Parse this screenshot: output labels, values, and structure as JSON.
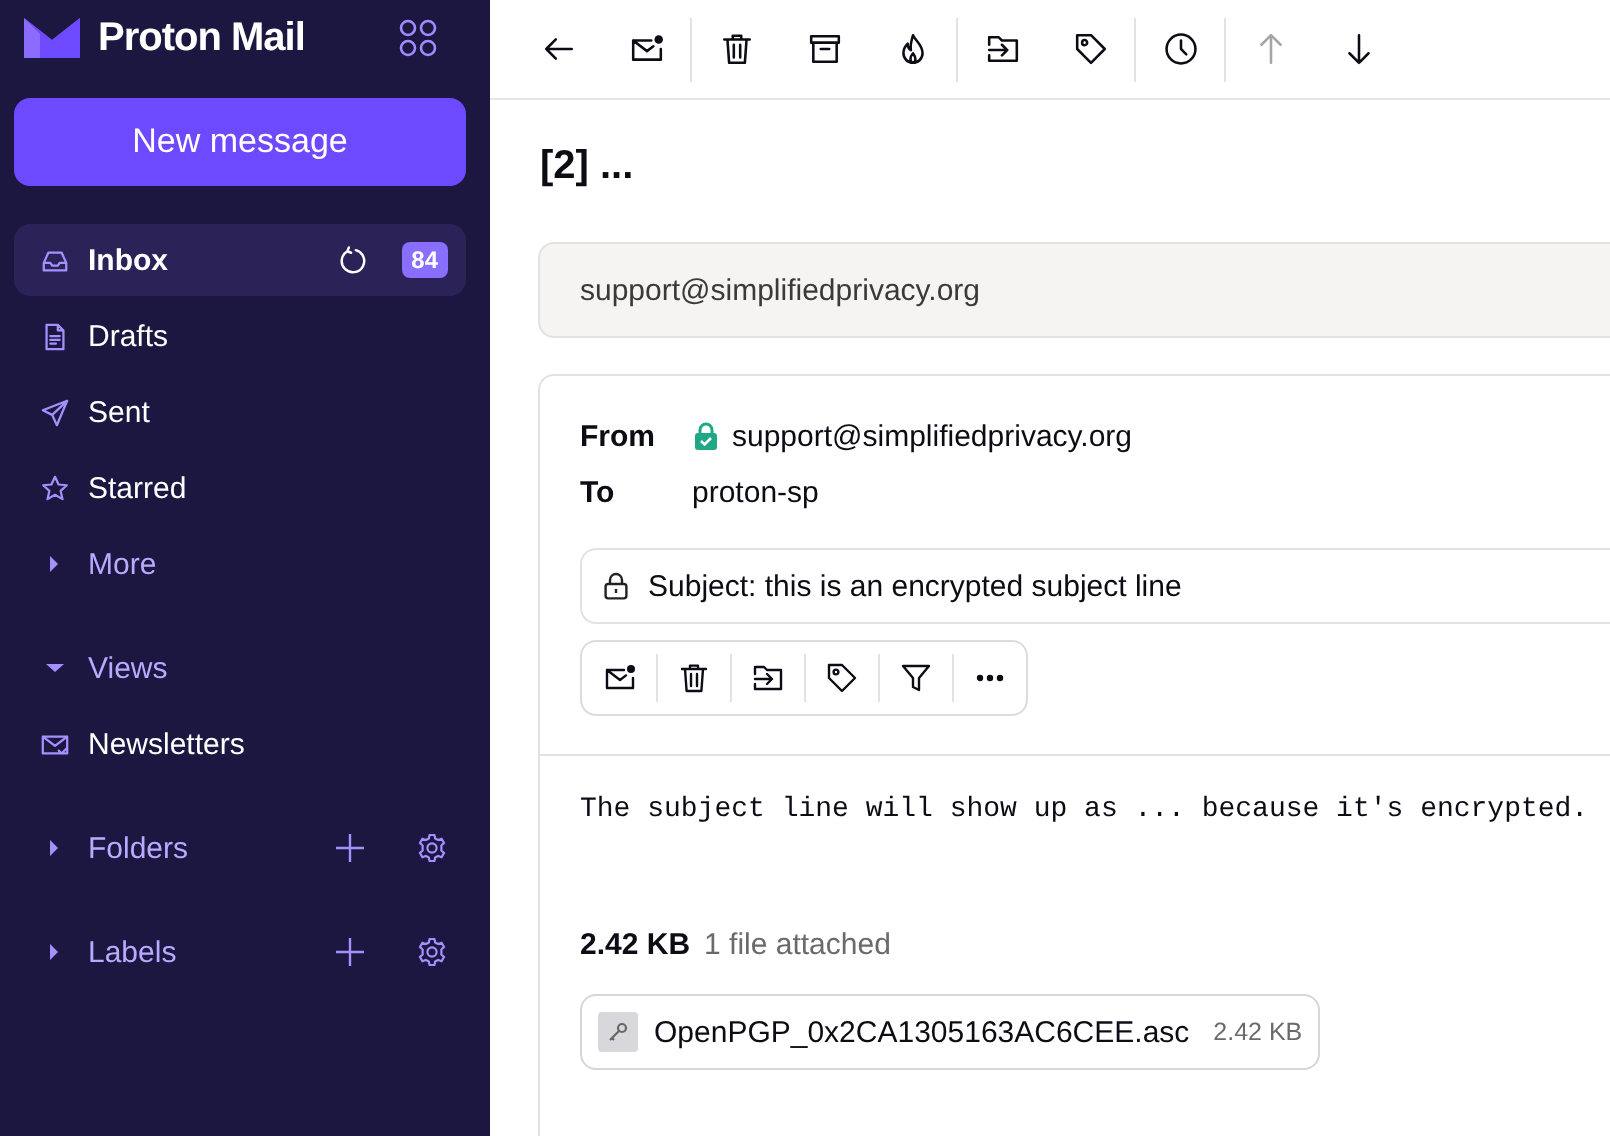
{
  "app": {
    "name": "Proton Mail"
  },
  "compose_button": "New message",
  "sidebar": {
    "items": [
      {
        "kind": "folder",
        "label": "Inbox",
        "selected": true,
        "count": "84"
      },
      {
        "kind": "folder",
        "label": "Drafts",
        "selected": false
      },
      {
        "kind": "folder",
        "label": "Sent",
        "selected": false
      },
      {
        "kind": "folder",
        "label": "Starred",
        "selected": false
      },
      {
        "kind": "toggle",
        "label": "More",
        "expanded": false
      },
      {
        "kind": "section",
        "label": "Views",
        "expanded": true
      },
      {
        "kind": "folder",
        "label": "Newsletters",
        "selected": false
      },
      {
        "kind": "category",
        "label": "Folders",
        "expanded": false
      },
      {
        "kind": "category",
        "label": "Labels",
        "expanded": false
      }
    ]
  },
  "toolbar": {
    "groups": [
      [
        {
          "disabled": false
        },
        {
          "disabled": false
        }
      ],
      [
        {
          "disabled": false
        },
        {
          "disabled": false
        },
        {
          "disabled": false
        }
      ],
      [
        {
          "disabled": false
        },
        {
          "disabled": false
        }
      ],
      [
        {
          "disabled": false
        }
      ],
      [
        {
          "disabled": true
        },
        {
          "disabled": false
        }
      ]
    ]
  },
  "conversation": {
    "title": "[2] ...",
    "collapsed_message": {
      "sender": "support@simplifiedprivacy.org"
    },
    "message": {
      "from_label": "From",
      "from": "support@simplifiedprivacy.org",
      "to_label": "To",
      "to": "proton-sp",
      "subject": "Subject: this is an encrypted subject line",
      "body": "The subject line will show up as ... because it's encrypted.",
      "attachments_size": "2.42 KB",
      "attachments_count": "1 file attached",
      "attachments": [
        {
          "name": "OpenPGP_0x2CA1305163AC6CEE.asc",
          "size": "2.42 KB"
        }
      ]
    }
  }
}
